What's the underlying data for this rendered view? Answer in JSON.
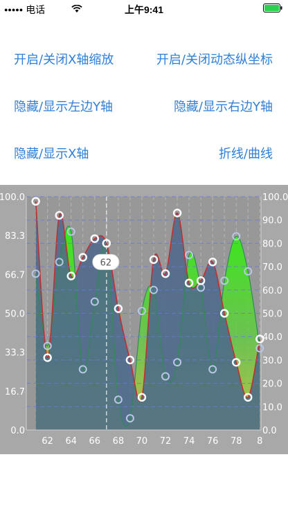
{
  "status_bar": {
    "carrier": "电话",
    "signal_dots": "●●●●●",
    "wifi_icon": "wifi-icon",
    "time": "上午9:41",
    "battery_icon": "battery-icon"
  },
  "buttons": {
    "toggle_x_zoom": "开启/关闭X轴缩放",
    "toggle_dynamic_y": "开启/关闭动态纵坐标",
    "toggle_left_y": "隐藏/显示左边Y轴",
    "toggle_right_y": "隐藏/显示右边Y轴",
    "toggle_x_axis": "隐藏/显示X轴",
    "line_curve": "折线/曲线"
  },
  "chart_data": {
    "type": "area",
    "x": [
      61,
      62,
      63,
      64,
      65,
      66,
      67,
      68,
      69,
      70,
      71,
      72,
      73,
      74,
      75,
      76,
      77,
      78,
      79,
      80
    ],
    "series": [
      {
        "values": [
          98,
          31,
          92,
          66,
          74,
          82,
          80,
          52,
          30,
          14,
          73,
          67,
          93,
          63,
          64,
          72,
          50,
          29,
          14,
          39
        ]
      },
      {
        "values": [
          67,
          36,
          72,
          85,
          26,
          55,
          80,
          13,
          5,
          51,
          60,
          23,
          29,
          75,
          61,
          26,
          64,
          83,
          68,
          35
        ]
      }
    ],
    "x_tick_labels": [
      "62",
      "64",
      "66",
      "68",
      "70",
      "72",
      "74",
      "76",
      "78",
      "8"
    ],
    "left_axis": {
      "ticks": [
        "0.0",
        "16.7",
        "33.3",
        "50.0",
        "66.7",
        "83.3",
        "100.0"
      ],
      "ylim": [
        0,
        100
      ]
    },
    "right_axis": {
      "ticks": [
        "0.0",
        "10.0",
        "20.0",
        "30.0",
        "40.0",
        "50.0",
        "60.0",
        "70.0",
        "80.0",
        "90.0",
        "100.0"
      ],
      "ylim": [
        0,
        100
      ]
    },
    "xlim": [
      60.2,
      80.1
    ],
    "highlight": {
      "x": 67,
      "label": "62"
    },
    "grid": true,
    "colors": {
      "panel_bg": "#a8a8a8",
      "plot_bg": "#989898",
      "series1_line": "#c03030",
      "series2_line": "#2e8b57",
      "fill_green": "#33ee11",
      "fill_dark": "#4a6a8a",
      "grid_h": "#6a7adb",
      "grid_v": "#d0d0d0"
    }
  }
}
